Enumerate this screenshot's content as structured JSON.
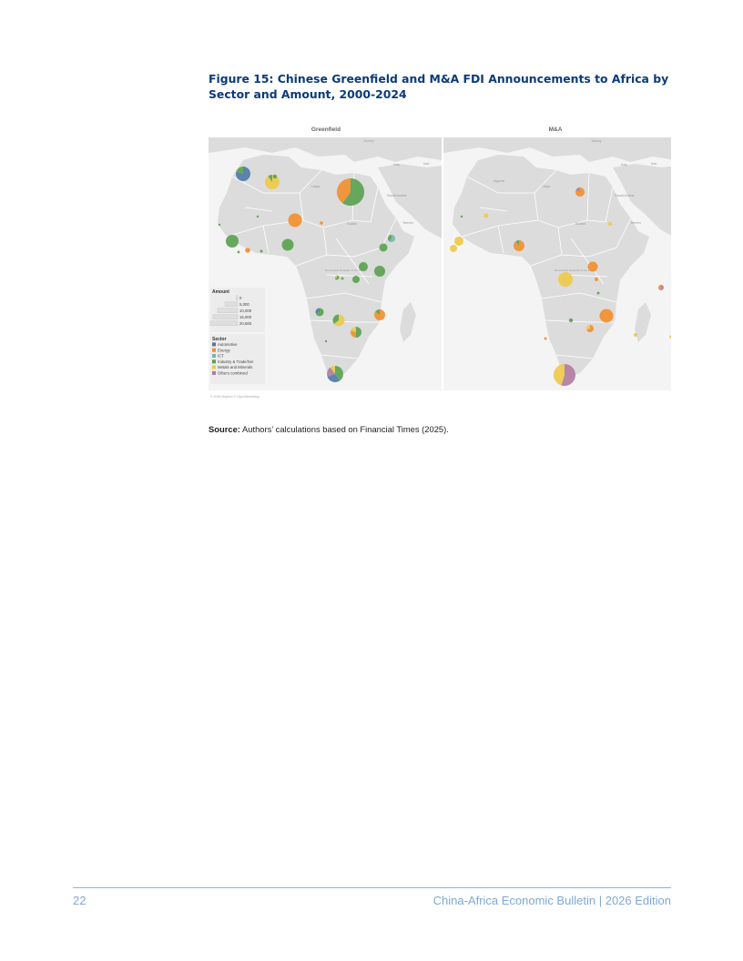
{
  "figure": {
    "title": "Figure 15: Chinese Greenfield and M&A FDI Announcements to Africa by Sector and Amount, 2000-2024",
    "panels": [
      {
        "key": "greenfield",
        "label": "Greenfield"
      },
      {
        "key": "ma",
        "label": "M&A"
      }
    ],
    "map_labels": {
      "greenfield": [
        "Turkey",
        "Iraq",
        "Iran",
        "Libya",
        "Saudi Arabia",
        "Sudan",
        "Yemen",
        "Democratic Republic of the Congo"
      ],
      "ma": [
        "Turkey",
        "Iraq",
        "Iran",
        "Algeria",
        "Libya",
        "Saudi Arabia",
        "Sudan",
        "Yemen",
        "Democratic Republic of the Congo"
      ]
    },
    "legend": {
      "amount_title": "Amount",
      "amount_entries": [
        "0",
        "5,000",
        "10,000",
        "15,000",
        "20,683"
      ],
      "sector_title": "Sector",
      "sectors": [
        {
          "name": "Automotive",
          "color": "#4e79a7"
        },
        {
          "name": "Energy",
          "color": "#f28e2b"
        },
        {
          "name": "ICT",
          "color": "#76b7b2"
        },
        {
          "name": "Industry & Trade/Ser",
          "color": "#59a14f"
        },
        {
          "name": "Metals and Minerals",
          "color": "#edc948"
        },
        {
          "name": "Others combined",
          "color": "#b07aa1"
        }
      ]
    },
    "attribution": "© 2026 Mapbox © OpenStreetMap",
    "colors": {
      "water": "#f4f4f4",
      "land": "#dcdcdc",
      "border": "#ffffff"
    }
  },
  "source": {
    "label": "Source:",
    "text": "Authors’ calculations based on Financial Times (2025)."
  },
  "footer": {
    "page_number": "22",
    "publication": "China-Africa Economic Bulletin",
    "separator": "|",
    "edition": "2026 Edition"
  }
}
